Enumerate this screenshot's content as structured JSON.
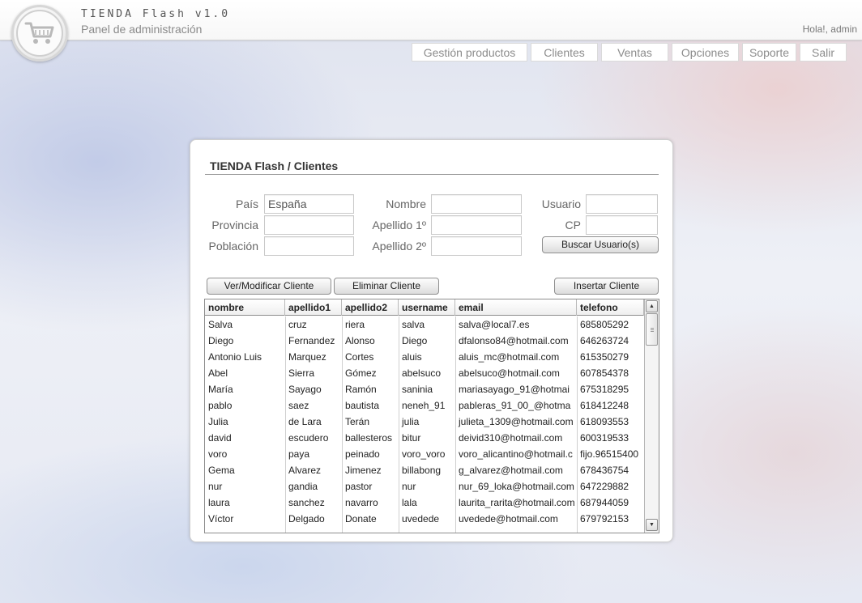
{
  "header": {
    "title": "TIENDA Flash v1.0",
    "subtitle": "Panel de administración",
    "greeting": "Hola!, admin"
  },
  "nav": [
    {
      "label": "Gestión productos"
    },
    {
      "label": "Clientes"
    },
    {
      "label": "Ventas"
    },
    {
      "label": "Opciones"
    },
    {
      "label": "Soporte"
    },
    {
      "label": "Salir"
    }
  ],
  "panel": {
    "title": "TIENDA Flash / Clientes"
  },
  "search": {
    "pais_label": "País",
    "pais_value": "España",
    "provincia_label": "Provincia",
    "provincia_value": "",
    "poblacion_label": "Población",
    "poblacion_value": "",
    "nombre_label": "Nombre",
    "nombre_value": "",
    "apellido1_label": "Apellido 1º",
    "apellido1_value": "",
    "apellido2_label": "Apellido 2º",
    "apellido2_value": "",
    "usuario_label": "Usuario",
    "usuario_value": "",
    "cp_label": "CP",
    "cp_value": "",
    "buscar_label": "Buscar Usuario(s)"
  },
  "actions": {
    "ver_label": "Ver/Modificar Cliente",
    "eliminar_label": "Eliminar Cliente",
    "insertar_label": "Insertar Cliente"
  },
  "table": {
    "columns": [
      "nombre",
      "apellido1",
      "apellido2",
      "username",
      "email",
      "telefono"
    ],
    "rows": [
      [
        "Salva",
        "cruz",
        "riera",
        "salva",
        "salva@local7.es",
        "685805292"
      ],
      [
        "Diego",
        "Fernandez",
        "Alonso",
        "Diego",
        "dfalonso84@hotmail.com",
        "646263724"
      ],
      [
        "Antonio Luis",
        "Marquez",
        "Cortes",
        "aluis",
        "aluis_mc@hotmail.com",
        "615350279"
      ],
      [
        "Abel",
        "Sierra",
        "Gómez",
        "abelsuco",
        "abelsuco@hotmail.com",
        "607854378"
      ],
      [
        "María",
        "Sayago",
        "Ramón",
        "saninia",
        "mariasayago_91@hotmai",
        "675318295"
      ],
      [
        "pablo",
        "saez",
        "bautista",
        "neneh_91",
        "pableras_91_00_@hotma",
        "618412248"
      ],
      [
        "Julia",
        "de Lara",
        "Terán",
        "julia",
        "julieta_1309@hotmail.com",
        "618093553"
      ],
      [
        "david",
        "escudero",
        "ballesteros",
        "bitur",
        "deivid310@hotmail.com",
        "600319533"
      ],
      [
        "voro",
        "paya",
        "peinado",
        "voro_voro",
        "voro_alicantino@hotmail.c",
        "fijo.96515400"
      ],
      [
        "Gema",
        "Alvarez",
        "Jimenez",
        "billabong",
        "g_alvarez@hotmail.com",
        "678436754"
      ],
      [
        "nur",
        "gandia",
        "pastor",
        "nur",
        "nur_69_loka@hotmail.com",
        "647229882"
      ],
      [
        "laura",
        "sanchez",
        "navarro",
        "lala",
        "laurita_rarita@hotmail.com",
        "687944059"
      ],
      [
        "Víctor",
        "Delgado",
        "Donate",
        "uvedede",
        "uvedede@hotmail.com",
        "679792153"
      ]
    ]
  },
  "icons": {
    "logo": "shopping-cart-icon",
    "scroll_up": "arrow-up-icon",
    "scroll_down": "arrow-down-icon"
  }
}
